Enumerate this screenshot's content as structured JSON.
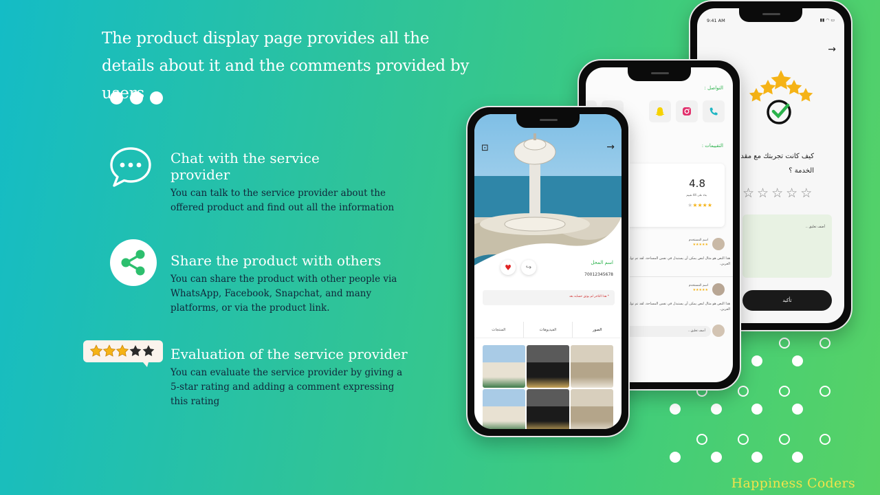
{
  "headline": "The product display page provides all the details about it and the comments provided by users",
  "features": [
    {
      "icon": "chat-bubble-icon",
      "title": "Chat with the service provider",
      "desc": "You can talk to the service provider about the offered product and find out all the information"
    },
    {
      "icon": "share-icon",
      "title": "Share the product with others",
      "desc": "You can share the product with other people via WhatsApp, Facebook, Snapchat, and many platforms, or via the product link."
    },
    {
      "icon": "star-rating-badge-icon",
      "title": "Evaluation of the service provider",
      "desc": "You can evaluate the service provider by giving a 5-star rating and adding a comment expressing this rating"
    }
  ],
  "brand": "Happiness Coders",
  "colors": {
    "accent_green": "#2bb24c",
    "brand_yellow": "#f2e24b",
    "star_gold": "#f5b316",
    "dark_button": "#1a1a1a"
  },
  "phone_product": {
    "store_name": "اسم المحل",
    "phone_number": "70012345678",
    "notice": "* هذا التاجر لم يوثق حسابه بعد",
    "tabs": [
      "المنتجات",
      "الفيديوهات",
      "الصور"
    ],
    "icons": [
      "add-cart-icon",
      "arrow-right-icon",
      "heart-icon",
      "share-icon"
    ]
  },
  "phone_reviews": {
    "contact_label": "التواصل :",
    "contact_icons": [
      "phone-icon",
      "instagram-icon",
      "snapchat-icon",
      "whatsapp-icon"
    ],
    "ratings_label": "التقييمات :",
    "average_rating": "4.8",
    "rating_count_label": "بناء على 44 تقييم",
    "rating_bars": [
      0.9,
      0.75,
      0.6,
      0.45,
      0.25
    ],
    "reviewer_name": "اسم المستخدم",
    "review_text": "هذا النص هو مثال لنص يمكن أن يستبدل في نفس المساحة، لقد تم توليد هذا النص من مولد النص العربي.",
    "comment_placeholder": "أضف تعليق..."
  },
  "phone_feedback": {
    "status_time": "9:41 AM",
    "question": "كيف كانت تجربتك مع مقدم الخدمة ؟",
    "comment_placeholder": "أضف تعليق ..",
    "confirm_label": "تأكيد",
    "empty_stars": 5
  }
}
